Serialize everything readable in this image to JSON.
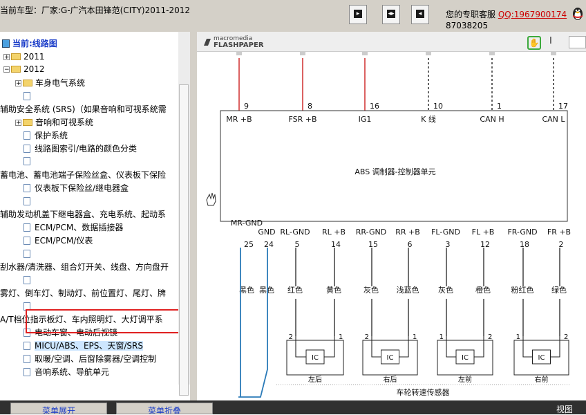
{
  "header": {
    "title": "当前车型：厂家:G-广汽本田锋范(CITY)2011-2012",
    "support_prefix": "您的专职客服",
    "support_qq": "QQ:1967900174",
    "support_line2": "87038205"
  },
  "tree": [
    {
      "label": "当前:线路图",
      "kind": "current"
    },
    {
      "label": "2011",
      "kind": "folder"
    },
    {
      "label": "2012",
      "kind": "folder"
    },
    {
      "label": "车身电气系统",
      "kind": "folder"
    },
    {
      "label": "",
      "kind": "doc"
    },
    {
      "label": "辅助安全系统 (SRS)（如果音响和可视系统需",
      "kind": "text"
    },
    {
      "label": "音响和可视系统",
      "kind": "folder"
    },
    {
      "label": "保护系统",
      "kind": "doc"
    },
    {
      "label": "线路图索引/电路的颜色分类",
      "kind": "doc"
    },
    {
      "label": "",
      "kind": "doc"
    },
    {
      "label": "蓄电池、蓄电池端子保险丝盒、仪表板下保险",
      "kind": "text"
    },
    {
      "label": "仪表板下保险丝/继电器盒",
      "kind": "doc"
    },
    {
      "label": "",
      "kind": "doc"
    },
    {
      "label": "辅助发动机盖下继电器盒、充电系统、起动系",
      "kind": "text"
    },
    {
      "label": "ECM/PCM、数据插接器",
      "kind": "doc"
    },
    {
      "label": "ECM/PCM/仪表",
      "kind": "doc"
    },
    {
      "label": "",
      "kind": "doc"
    },
    {
      "label": "刮水器/清洗器、组合灯开关、线盘、方向盘开",
      "kind": "text"
    },
    {
      "label": "",
      "kind": "doc"
    },
    {
      "label": "雾灯、倒车灯、制动灯、前位置灯、尾灯、牌",
      "kind": "text"
    },
    {
      "label": "",
      "kind": "doc"
    },
    {
      "label": "A/T档位指示板灯、车内照明灯、大灯调平系",
      "kind": "text"
    },
    {
      "label": "电动车窗、电动后视镜",
      "kind": "doc"
    },
    {
      "label": "MICU/ABS、EPS、天窗/SRS",
      "kind": "doc"
    },
    {
      "label": "取暖/空调、后窗除雾器/空调控制",
      "kind": "doc"
    },
    {
      "label": "音响系统、导航单元",
      "kind": "doc"
    }
  ],
  "viewer": {
    "brand_top": "macromedia",
    "brand_main": "FLASHPAPER"
  },
  "diagram": {
    "module_label": "ABS 调制器-控制器单元",
    "top_pins": [
      {
        "num": "9",
        "label": "MR +B"
      },
      {
        "num": "8",
        "label": "FSR +B"
      },
      {
        "num": "16",
        "label": "IG1"
      },
      {
        "num": "10",
        "label": "K 线"
      },
      {
        "num": "1",
        "label": "CAN H"
      },
      {
        "num": "17",
        "label": "CAN L"
      }
    ],
    "bottom_pins": [
      {
        "num": "25",
        "label": "MR-GND",
        "color": "黑色"
      },
      {
        "num": "24",
        "label": "GND",
        "color": "黑色"
      },
      {
        "num": "5",
        "label": "RL-GND",
        "color": "红色"
      },
      {
        "num": "14",
        "label": "RL +B",
        "color": "黄色"
      },
      {
        "num": "15",
        "label": "RR-GND",
        "color": "灰色"
      },
      {
        "num": "6",
        "label": "RR +B",
        "color": "浅蓝色"
      },
      {
        "num": "3",
        "label": "FL-GND",
        "color": "灰色"
      },
      {
        "num": "12",
        "label": "FL +B",
        "color": "橙色"
      },
      {
        "num": "18",
        "label": "FR-GND",
        "color": "粉红色"
      },
      {
        "num": "2",
        "label": "FR +B",
        "color": "绿色"
      }
    ],
    "sensors": [
      {
        "name": "左后",
        "left_pin": "2",
        "right_pin": "1",
        "ic": "IC"
      },
      {
        "name": "右后",
        "left_pin": "2",
        "right_pin": "1",
        "ic": "IC"
      },
      {
        "name": "左前",
        "left_pin": "1",
        "right_pin": "2",
        "ic": "IC"
      },
      {
        "name": "右前",
        "left_pin": "1",
        "right_pin": "2",
        "ic": "IC"
      }
    ],
    "sensor_group": "车轮转速传感器"
  },
  "bottom": {
    "btn_expand": "菜单展开",
    "btn_collapse": "菜单折叠",
    "view": "视图"
  },
  "colors": {
    "wire_red": "#d23a3a",
    "wire_blue": "#2a7ab8",
    "highlight": "#e02020",
    "qq": "#cc0000"
  }
}
